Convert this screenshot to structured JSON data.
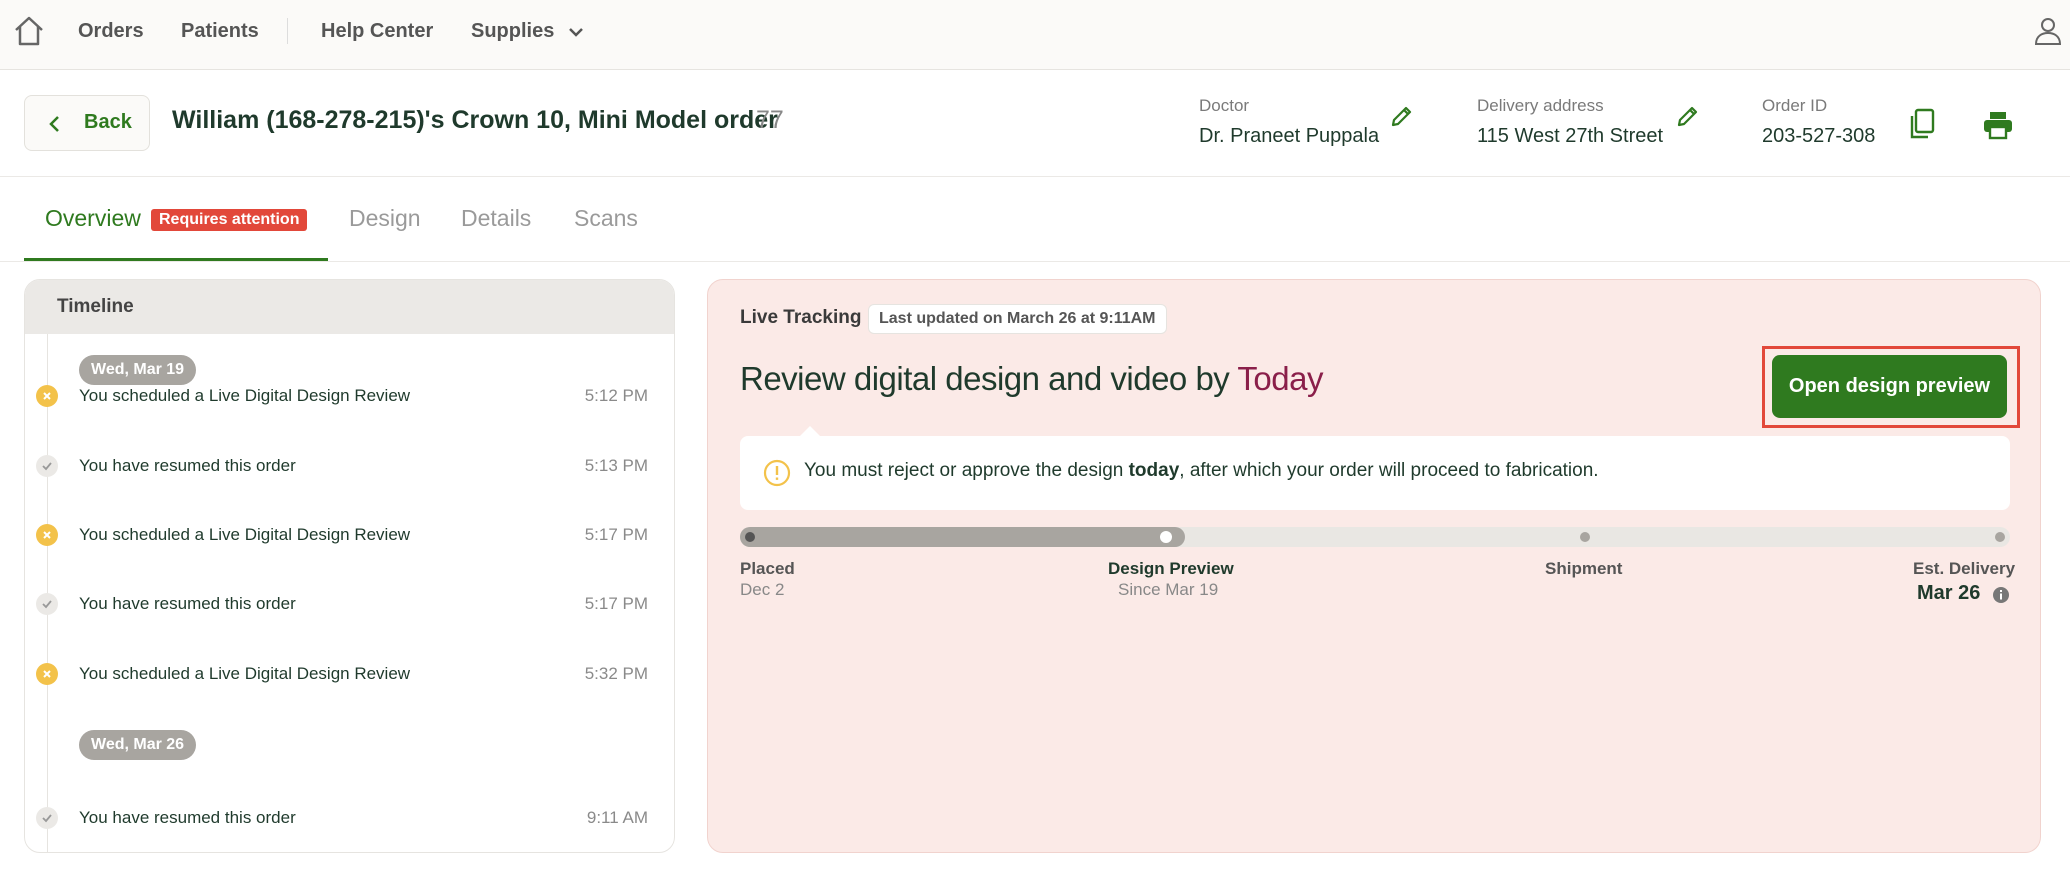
{
  "nav": {
    "items": [
      {
        "label": "Orders"
      },
      {
        "label": "Patients"
      },
      {
        "label": "Help Center"
      },
      {
        "label": "Supplies"
      }
    ]
  },
  "header": {
    "back_label": "Back",
    "title": "William (168-278-215)'s Crown 10, Mini Model order",
    "count": "77",
    "doctor_label": "Doctor",
    "doctor_value": "Dr. Praneet Puppala",
    "address_label": "Delivery address",
    "address_value": "115 West 27th Street",
    "order_id_label": "Order ID",
    "order_id_value": "203-527-308"
  },
  "tabs": {
    "overview": "Overview",
    "badge": "Requires attention",
    "design": "Design",
    "details": "Details",
    "scans": "Scans"
  },
  "timeline": {
    "title": "Timeline",
    "dates": [
      "Wed, Mar 19",
      "Wed, Mar 26"
    ],
    "events": [
      {
        "text": "You scheduled a Live Digital Design Review",
        "time": "5:12 PM",
        "status": "warn"
      },
      {
        "text": "You have resumed this order",
        "time": "5:13 PM",
        "status": "done"
      },
      {
        "text": "You scheduled a Live Digital Design Review",
        "time": "5:17 PM",
        "status": "warn"
      },
      {
        "text": "You have resumed this order",
        "time": "5:17 PM",
        "status": "done"
      },
      {
        "text": "You scheduled a Live Digital Design Review",
        "time": "5:32 PM",
        "status": "warn"
      },
      {
        "text": "You have resumed this order",
        "time": "9:11 AM",
        "status": "done"
      }
    ]
  },
  "tracking": {
    "label": "Live Tracking",
    "updated": "Last updated on March 26 at 9:11AM",
    "title_prefix": "Review digital design and video by ",
    "title_highlight": "Today",
    "button": "Open design preview",
    "notice_prefix": "You must reject or approve the design ",
    "notice_bold": "today",
    "notice_suffix": ", after which your order will proceed to fabrication.",
    "progress": 0.35,
    "steps": [
      {
        "label": "Placed",
        "sub": "Dec 2"
      },
      {
        "label": "Design Preview",
        "sub": "Since Mar 19"
      },
      {
        "label": "Shipment",
        "sub": ""
      },
      {
        "label": "Est. Delivery",
        "sub": "Mar 26"
      }
    ]
  },
  "colors": {
    "brand_green": "#2f7a1f",
    "attention_red": "#e2483a",
    "today_accent": "#8a1f4a",
    "warn_yellow": "#f3c24a"
  }
}
